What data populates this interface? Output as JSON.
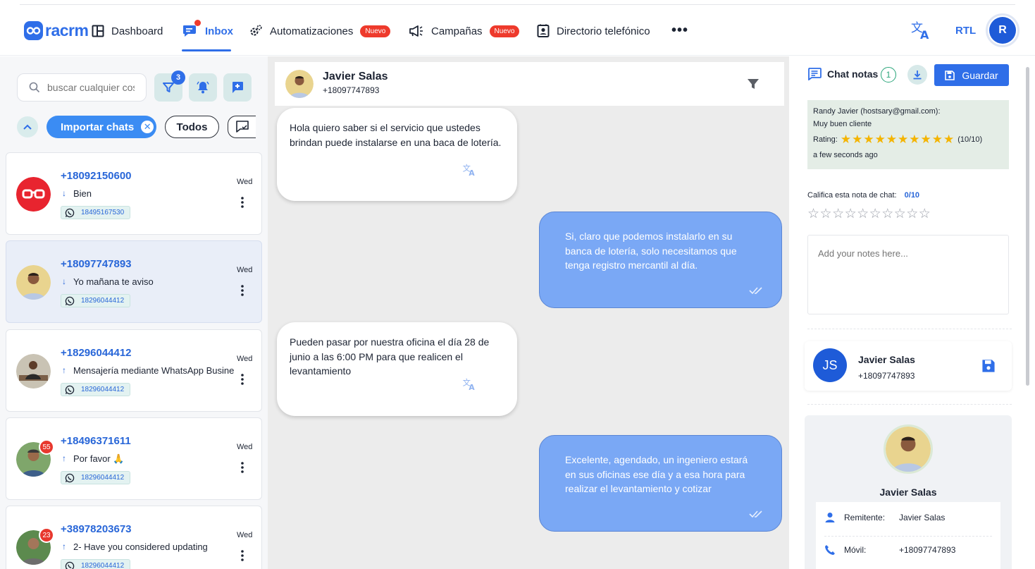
{
  "nav": {
    "logo_text": "racrm",
    "items": [
      {
        "label": "Dashboard"
      },
      {
        "label": "Inbox"
      },
      {
        "label": "Automatizaciones",
        "badge": "Nuevo"
      },
      {
        "label": "Campañas",
        "badge": "Nuevo"
      },
      {
        "label": "Directorio telefónico"
      }
    ],
    "active": "Inbox",
    "more": "•••",
    "rtl": "RTL",
    "user_initial": "R",
    "colors": {
      "accent": "#2f6ee8",
      "badge": "#ee3a2c"
    }
  },
  "sidebar": {
    "search_placeholder": "buscar cualquier cosa",
    "filter_count": "3",
    "chips": {
      "import": "Importar chats",
      "all": "Todos"
    },
    "chats": [
      {
        "phone": "+18092150600",
        "day": "Wed",
        "direction": "in",
        "message": "Bien",
        "wa_number": "18495167530",
        "avatar": "glasses-icon",
        "unread": ""
      },
      {
        "phone": "+18097747893",
        "day": "Wed",
        "direction": "in",
        "message": "Yo mañana te aviso",
        "wa_number": "18296044412",
        "avatar": "photo",
        "unread": "",
        "selected": true
      },
      {
        "phone": "+18296044412",
        "day": "Wed",
        "direction": "out",
        "message": "Mensajería mediante WhatsApp Business",
        "wa_number": "18296044412",
        "avatar": "photo",
        "unread": ""
      },
      {
        "phone": "+18496371611",
        "day": "Wed",
        "direction": "out",
        "message": "Por favor 🙏",
        "wa_number": "18296044412",
        "avatar": "photo",
        "unread": "55"
      },
      {
        "phone": "+38978203673",
        "day": "Wed",
        "direction": "out",
        "message": "2- Have you considered updating",
        "wa_number": "18296044412",
        "avatar": "photo",
        "unread": "23"
      }
    ]
  },
  "chat": {
    "contact_name": "Javier Salas",
    "contact_phone": "+18097747893",
    "messages": [
      {
        "dir": "in",
        "text": "Hola quiero saber si el servicio que ustedes brindan puede instalarse en una baca de lotería."
      },
      {
        "dir": "out",
        "text": "Si, claro que podemos instalarlo en su banca de lotería, solo necesitamos que tenga registro mercantil al día."
      },
      {
        "dir": "in",
        "text": "Pueden pasar por nuestra oficina el día 28 de junio a las 6:00 PM para que realicen el levantamiento"
      },
      {
        "dir": "out",
        "text": "Excelente, agendado, un ingeniero estará en sus oficinas ese día y a esa hora para realizar el levantamiento y cotizar"
      }
    ]
  },
  "notes": {
    "title": "Chat notas",
    "count": "1",
    "save_label": "Guardar",
    "note": {
      "author": "Randy Javier (hostsary@gmail.com):",
      "text": "Muy buen cliente",
      "rating_label": "Rating:",
      "rating_score": "(10/10)",
      "rating": 10,
      "time": "a few seconds ago"
    },
    "rate_prompt": "Califica esta nota de chat:",
    "rate_value": "0/10",
    "empty_stars": "☆☆☆☆☆☆☆☆☆☆",
    "placeholder": "Add your notes here...",
    "stars_full": "★★★★★★★★★★"
  },
  "contact": {
    "initials": "JS",
    "name": "Javier Salas",
    "phone": "+18097747893"
  },
  "profile": {
    "name": "Javier Salas",
    "sender_label": "Remitente:",
    "sender_value": "Javier Salas",
    "mobile_label": "Móvil:",
    "mobile_value": "+18097747893"
  }
}
